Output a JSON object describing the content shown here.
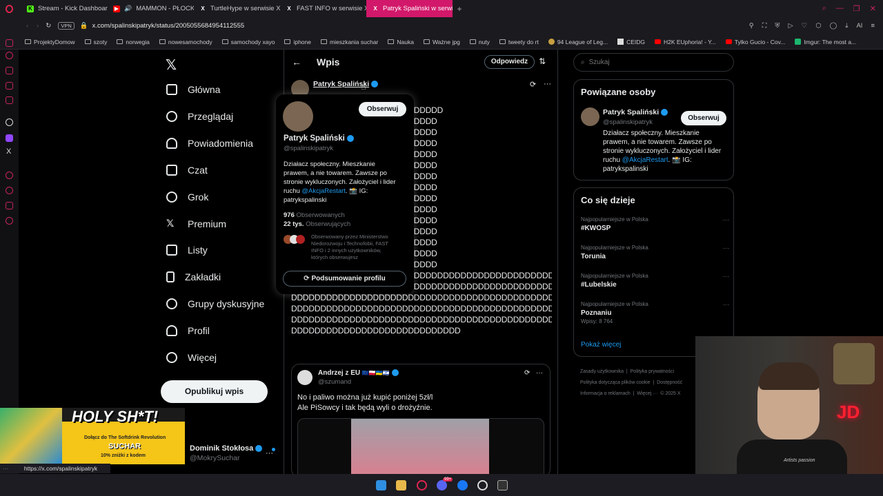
{
  "tabs": [
    {
      "label": "Stream - Kick Dashboard",
      "icon": "kick-icon",
      "color": "#53fc18"
    },
    {
      "label": "MAMMON - PŁOCKIE",
      "icon": "youtube-icon",
      "color": "#ff0000"
    },
    {
      "label": "TurtleHype w serwisie X:",
      "icon": "x-icon",
      "color": "#ffffff"
    },
    {
      "label": "FAST INFO w serwisie X:",
      "icon": "x-icon",
      "color": "#ffffff"
    },
    {
      "label": "Patryk Spaliński w serwisi",
      "icon": "x-icon",
      "color": "#ffffff"
    }
  ],
  "address": {
    "url": "x.com/spalinskipatryk/status/2005055684954112555",
    "vpn": "VPN"
  },
  "bookmarks": [
    "ProjektyDomow",
    "szoty",
    "norwegia",
    "nowesamochody",
    "samochody xayo",
    "iphone",
    "mieszkania suchar",
    "Nauka",
    "Ważne jpg",
    "nuty",
    "tweety do rt",
    "94 League of Leg...",
    "CEIDG",
    "H2K EUphoria! - Y...",
    "Tylko Gucio - Cov...",
    "Imgur: The most a..."
  ],
  "nav": [
    {
      "label": "Główna",
      "icon": "home-icon"
    },
    {
      "label": "Przeglądaj",
      "icon": "search-icon"
    },
    {
      "label": "Powiadomienia",
      "icon": "bell-icon"
    },
    {
      "label": "Czat",
      "icon": "mail-icon"
    },
    {
      "label": "Grok",
      "icon": "grok-icon"
    },
    {
      "label": "Premium",
      "icon": "x-icon"
    },
    {
      "label": "Listy",
      "icon": "list-icon"
    },
    {
      "label": "Zakładki",
      "icon": "bookmark-icon"
    },
    {
      "label": "Grupy dyskusyjne",
      "icon": "people-icon"
    },
    {
      "label": "Profil",
      "icon": "person-icon"
    },
    {
      "label": "Więcej",
      "icon": "more-icon"
    }
  ],
  "post_button": "Opublikuj wpis",
  "account": {
    "name": "Dominik Stokłosa",
    "handle": "@MokrySuchar"
  },
  "header": {
    "title": "Wpis",
    "reply": "Odpowiedz"
  },
  "post": {
    "author": "Patryk Spaliński",
    "handle": "@spalinskipatryk",
    "lines": [
      "DDDDDDDDDDDDDDDDDDDDDDDDDD",
      "DDDDDDDDDDDDDDDDDDDDDDDDD",
      "DDDDDDDDDDDDDDDDDDDDDDDDD",
      "DDDDDDDDDDDDDDDDDDDDDDDDD",
      "DDDDDDDDDDDDDDDDDDDDDDDDD",
      "DDDDDDDDDDDDDDDDDDDDDDDDD",
      "DDDDDDDDDDDDDDDDDDDDDDDDD",
      "DDDDDDDDDDDDDDDDDDDDDDDDD",
      "DDDDDDDDDDDDDDDDDDDDDDDDD",
      "DDDDDDDDDDDDDDDDDDDDDDDDD",
      "DDDDDDDDDDDDDDDDDDDDDDDDD",
      "DDDDDDDDDDDDDDDDDDDDDDDDD",
      "DDDDDDDDDDDDDDDDDDDDDDDDD",
      "DDDDDDDDDDDDDDDDDDDDDDDDD",
      "DDDDDDDDDDDDDDDDDDDDDDDDD",
      "DDDDDDDDDDDDDDDDDDDDDDDDDDDDDDDDDDDDDDDDDDDDDDD",
      "DDDDDDDDDDDDDDDDDDDDDDDDDDDDDDDDDDDDDDDDDDDDDDD",
      "DDDDDDDDDDDDDDDDDDDDDDDDDDDDDDDDDDDDDDDDDDDDDDD",
      "DDDDDDDDDDDDDDDDDDDDDDDDDDDDDDDDDDDDDDDDDDDDDDD",
      "DDDDDDDDDDDDDDDDDDDDDDDDDDDDDDDDDDDDDDDDDDDDDDD",
      "DDDDDDDDDDDDDDDDDDDDDDDDDDDDD"
    ]
  },
  "quote": {
    "author": "Andrzej z EU",
    "handle": "@szumand",
    "text1": "No i paliwo można już kupić poniżej 5zł/l",
    "text2": "Ale PiSowcy i tak będą wyli o drożyźnie."
  },
  "hovercard": {
    "name": "Patryk Spaliński",
    "handle": "@spalinskipatryk",
    "follow": "Obserwuj",
    "bio1": "Działacz społeczny. Mieszkanie",
    "bio2": "prawem, a nie towarem. Zawsze po",
    "bio3": "stronie wykluczonych. Założyciel i lider",
    "bio4_pre": "ruchu ",
    "bio4_link": "@AkcjaRestart",
    "bio4_post": ". 📸 IG:",
    "bio5": "patrykspalinski",
    "following_count": "976",
    "following_label": "Obserwowanych",
    "followers_count": "22 tys.",
    "followers_label": "Obserwujących",
    "mutual1": "Obserwowany przez Ministerstwo",
    "mutual2": "Niedorozwoju i Technofobii, FAST",
    "mutual3": "INFO i 2 innych użytkowników,",
    "mutual4": "których obserwujesz",
    "summary": "Podsumowanie profilu"
  },
  "search": {
    "placeholder": "Szukaj"
  },
  "related": {
    "title": "Powiązane osoby",
    "name": "Patryk Spaliński",
    "handle": "@spalinskipatryk",
    "follow": "Obserwuj",
    "bio1": "Działacz społeczny. Mieszkanie",
    "bio2": "prawem, a nie towarem. Zawsze po",
    "bio3": "stronie wykluczonych. Założyciel i lider",
    "bio4_pre": "ruchu ",
    "bio4_link": "@AkcjaRestart",
    "bio4_post": ". 📸 IG:",
    "bio5": "patrykspalinski"
  },
  "trends": {
    "title": "Co się dzieje",
    "items": [
      {
        "context": "Najpopularniejsze w Polska",
        "name": "#KWOSP",
        "count": ""
      },
      {
        "context": "Najpopularniejsze w Polska",
        "name": "Torunia",
        "count": ""
      },
      {
        "context": "Najpopularniejsze w Polska",
        "name": "#Lubelskie",
        "count": ""
      },
      {
        "context": "Najpopularniejsze w Polska",
        "name": "Poznaniu",
        "count": "Wpisy: 8 764"
      }
    ],
    "more": "Pokaż więcej"
  },
  "footer": {
    "l1a": "Zasady użytkownika",
    "l1b": "Polityka prywatności",
    "l2a": "Polityka dotycząca plików cookie",
    "l2b": "Dostępność",
    "l3a": "Informacja o reklamach",
    "l3b": "Więcej ···",
    "l3c": "© 2025 X"
  },
  "status_url": "https://x.com/spalinskipatryk",
  "ad": {
    "headline": "HOLY SH*T!",
    "line1": "Dołącz do The Softdrink Revolution",
    "brand": "SUCHAR",
    "line2": "10% zniżki z kodem"
  },
  "webcam": {
    "sign": "JD",
    "shirt": "Artists passion"
  },
  "taskbar_badge": "99+"
}
